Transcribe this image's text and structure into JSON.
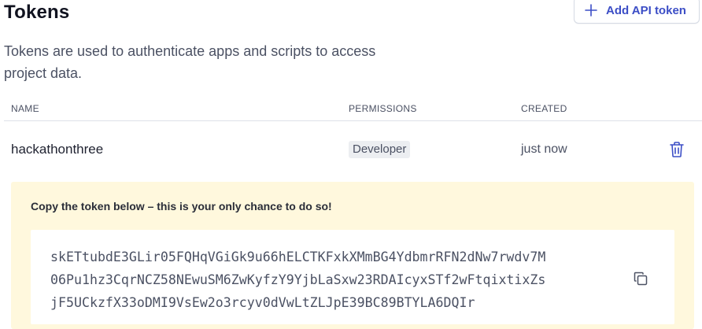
{
  "header": {
    "title": "Tokens",
    "add_button_label": "Add API token"
  },
  "description": "Tokens are used to authenticate apps and scripts to access project data.",
  "table": {
    "columns": [
      "NAME",
      "PERMISSIONS",
      "CREATED"
    ],
    "rows": [
      {
        "name": "hackathonthree",
        "permission": "Developer",
        "created": "just now"
      }
    ]
  },
  "token_notice": {
    "message": "Copy the token below – this is your only chance to do so!",
    "token_lines": [
      "skETtubdE3GLir05FQHqVGiGk9u66hELCTKFxkXMmBG4YdbmrRFN2dNw7rwdv7M",
      "06Pu1hz3CqrNCZ58NEwuSM6ZwKyfzY9YjbLaSxw23RDAIcyxSTf2wFtqixtixZs",
      "jF5UCkzfX33oDMI9VsEw2o3rcyv0dVwLtZLJpE39BC89BTYLA6DQIr"
    ]
  },
  "icons": {
    "add": "plus-icon",
    "delete": "trash-icon",
    "copy": "copy-icon"
  },
  "colors": {
    "accent": "#3c4ec6",
    "notice_background": "#fff8dd"
  }
}
